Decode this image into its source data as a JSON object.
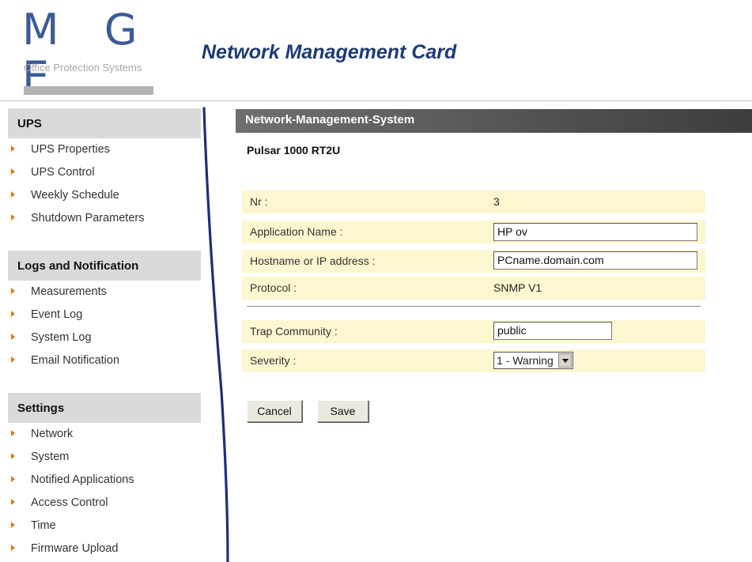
{
  "brand": {
    "logo_text": "M G E",
    "logo_subtitle": "Office Protection Systems",
    "card_title": "Network  Management  Card",
    "colors": {
      "logo": "#3a5b96",
      "title": "#1c3a76",
      "bullet": "#e07a12",
      "row_bg": "#fdf7d0",
      "swoosh": "#1f2d7a"
    }
  },
  "sidebar": {
    "sections": [
      {
        "title": "UPS",
        "items": [
          "UPS Properties",
          "UPS Control",
          "Weekly Schedule",
          "Shutdown Parameters"
        ]
      },
      {
        "title": "Logs and Notification",
        "items": [
          "Measurements",
          "Event Log",
          "System Log",
          "Email Notification"
        ]
      },
      {
        "title": "Settings",
        "items": [
          "Network",
          "System",
          "Notified Applications",
          "Access Control",
          "Time",
          "Firmware Upload"
        ]
      }
    ]
  },
  "panel": {
    "header": "Network-Management-System",
    "device": "Pulsar 1000 RT2U",
    "fields": {
      "nr": {
        "label": "Nr :",
        "value": "3"
      },
      "app_name": {
        "label": "Application Name :",
        "value": "HP ov"
      },
      "hostname": {
        "label": "Hostname or IP address :",
        "value": "PCname.domain.com"
      },
      "protocol": {
        "label": "Protocol :",
        "value": "SNMP V1"
      },
      "trap": {
        "label": "Trap Community :",
        "value": "public"
      },
      "severity": {
        "label": "Severity :",
        "value": "1 - Warning"
      }
    },
    "buttons": {
      "cancel": "Cancel",
      "save": "Save"
    }
  }
}
